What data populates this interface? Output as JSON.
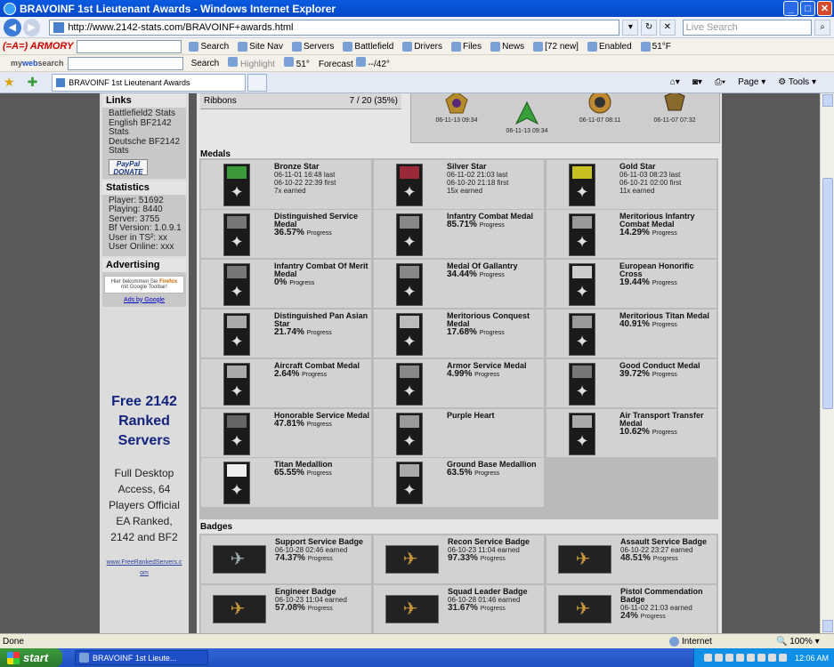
{
  "window": {
    "title": "BRAVOINF 1st Lieutenant Awards - Windows Internet Explorer"
  },
  "address": {
    "url": "http://www.2142-stats.com/BRAVOINF+awards.html",
    "live_search_placeholder": "Live Search"
  },
  "toolbar1": {
    "brand": "(=A=) ARMORY",
    "search": "Search",
    "site_nav": "Site Nav",
    "servers": "Servers",
    "battlefield": "Battlefield",
    "drivers": "Drivers",
    "files": "Files",
    "news": "News",
    "new_count": "[72 new]",
    "enabled": "Enabled",
    "temp": "51°F"
  },
  "toolbar2": {
    "brand_a": "my",
    "brand_b": "web",
    "brand_c": "search",
    "search": "Search",
    "highlight": "Highlight",
    "temp": "51°",
    "forecast": "Forecast",
    "forecast_temp": "--/42°"
  },
  "tab": {
    "label": "BRAVOINF 1st Lieutenant Awards",
    "page": "Page",
    "tools": "Tools"
  },
  "sidebar": {
    "links_title": "Links",
    "links": [
      "Battlefield2 Stats",
      "English BF2142 Stats",
      "Deutsche BF2142 Stats"
    ],
    "paypal": "PayPal DONATE",
    "stats_title": "Statistics",
    "stats": [
      "Player: 51692",
      "Playing: 8440",
      "Server: 3755",
      "Bf Version: 1.0.9.1",
      "User in TS²: xx",
      "User Online: xxx"
    ],
    "advertising_title": "Advertising",
    "ad_text_a": "Hier bekommen Sie",
    "ad_text_b": "Firefox",
    "ad_text_c": "mit Google Toolbar!",
    "ads_by_google": "Ads by Google",
    "free_text": "Free 2142 Ranked Servers",
    "access_text": "Full Desktop Access, 64 Players Official EA Ranked, 2142 and BF2",
    "free_link": "www.FreeRankedServers.com"
  },
  "ribbons": {
    "label": "Ribbons",
    "count": "7 / 20 (35%)",
    "items": [
      {
        "date": "06-11-13 09:34",
        "color": "#b58a2a"
      },
      {
        "date": "06-11-13 09:34",
        "color": "#3aa03a"
      },
      {
        "date": "06-11-07 08:11",
        "color": "#c08a30"
      },
      {
        "date": "06-11-07 07:32",
        "color": "#8a6a2a"
      }
    ]
  },
  "medals_title": "Medals",
  "medals": [
    {
      "name": "Bronze Star",
      "l1": "06-11-01 16:48 last",
      "l2": "06-10-22 22:39 first",
      "l3": "7x earned",
      "band": "#3c9a3c",
      "progress": ""
    },
    {
      "name": "Silver Star",
      "l1": "06-11-02 21:03 last",
      "l2": "06-10-20 21:18 first",
      "l3": "15x earned",
      "band": "#9a2a3a",
      "progress": ""
    },
    {
      "name": "Gold Star",
      "l1": "06-11-03 08:23 last",
      "l2": "06-10-21 02:00 first",
      "l3": "11x earned",
      "band": "#c8c020",
      "progress": ""
    },
    {
      "name": "Distinguished Service Medal",
      "progress": "36.57%",
      "band": "#777"
    },
    {
      "name": "Infantry Combat Medal",
      "progress": "85.71%",
      "band": "#888"
    },
    {
      "name": "Meritorious Infantry Combat Medal",
      "progress": "14.29%",
      "band": "#999"
    },
    {
      "name": "Infantry Combat Of Merit Medal",
      "progress": "0%",
      "band": "#777"
    },
    {
      "name": "Medal Of Gallantry",
      "progress": "34.44%",
      "band": "#888"
    },
    {
      "name": "European Honorific Cross",
      "progress": "19.44%",
      "band": "#ccc"
    },
    {
      "name": "Distinguished Pan Asian Star",
      "progress": "21.74%",
      "band": "#aaa"
    },
    {
      "name": "Meritorious Conquest Medal",
      "progress": "17.68%",
      "band": "#bbb"
    },
    {
      "name": "Meritorious Titan Medal",
      "progress": "40.91%",
      "band": "#999"
    },
    {
      "name": "Aircraft Combat Medal",
      "progress": "2.64%",
      "band": "#aaa"
    },
    {
      "name": "Armor Service Medal",
      "progress": "4.99%",
      "band": "#888"
    },
    {
      "name": "Good Conduct Medal",
      "progress": "39.72%",
      "band": "#777"
    },
    {
      "name": "Honorable Service Medal",
      "progress": "47.81%",
      "band": "#666"
    },
    {
      "name": "Purple Heart",
      "progress": "",
      "band": "#999"
    },
    {
      "name": "Air Transport Transfer Medal",
      "progress": "10.62%",
      "band": "#aaa"
    },
    {
      "name": "Titan Medallion",
      "progress": "65.55%",
      "band": "#eee"
    },
    {
      "name": "Ground Base Medallion",
      "progress": "63.5%",
      "band": "#aaa"
    }
  ],
  "progress_word": "Progress",
  "badges_title": "Badges",
  "badges": [
    {
      "name": "Support Service Badge",
      "date": "06-10-28 02:46 earned",
      "progress": "74.37%",
      "grey": true
    },
    {
      "name": "Recon Service Badge",
      "date": "06-10-23 11:04 earned",
      "progress": "97.33%",
      "grey": false
    },
    {
      "name": "Assault Service Badge",
      "date": "06-10-22 23:27 earned",
      "progress": "48.51%",
      "grey": false
    },
    {
      "name": "Engineer Badge",
      "date": "06-10-23 11:04 earned",
      "progress": "57.08%",
      "grey": false
    },
    {
      "name": "Squad Leader Badge",
      "date": "06-10-28 01:46 earned",
      "progress": "31.67%",
      "grey": false
    },
    {
      "name": "Pistol Commendation Badge",
      "date": "06-11-02 21:03 earned",
      "progress": "24%",
      "grey": false
    }
  ],
  "status": {
    "left": "Done",
    "zone": "Internet",
    "zoom": "100%"
  },
  "taskbar": {
    "start": "start",
    "item": "BRAVOINF 1st Lieute...",
    "clock": "12:06 AM"
  }
}
